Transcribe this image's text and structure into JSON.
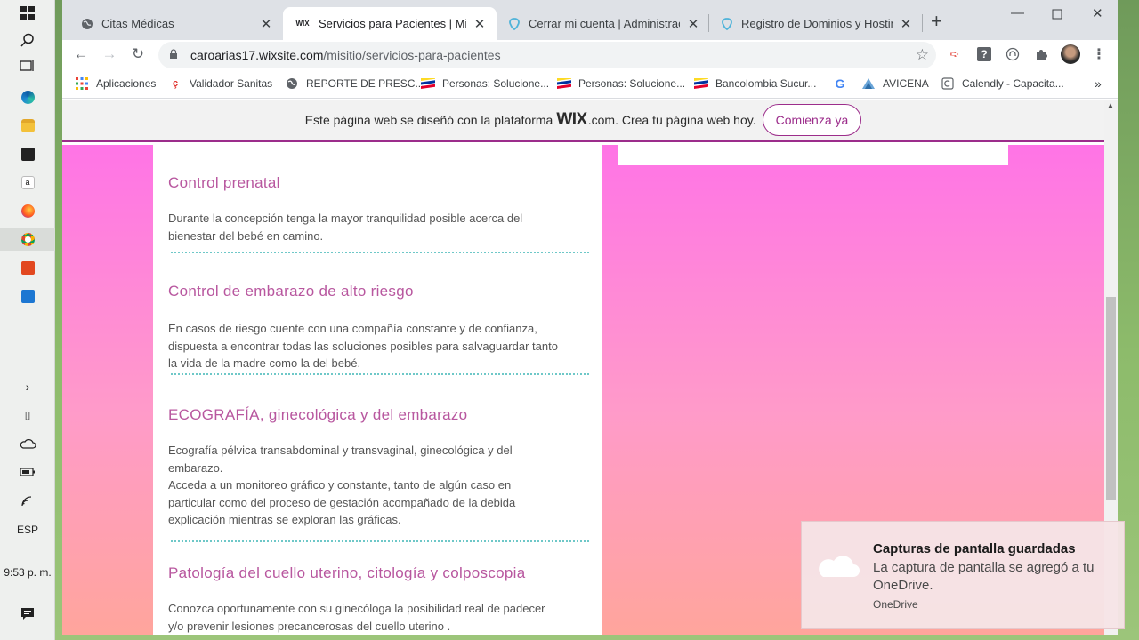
{
  "taskbar": {
    "language": "ESP",
    "clock": "9:53 p. m."
  },
  "tabs": [
    {
      "title": "Citas Médicas",
      "favicon": "globe-icon"
    },
    {
      "title": "Servicios para Pacientes | Misitio",
      "favicon": "wix-icon",
      "favicon_text": "WIX"
    },
    {
      "title": "Cerrar mi cuenta | Administración",
      "favicon": "hostinger-icon"
    },
    {
      "title": "Registro de Dominios y Hosting e",
      "favicon": "hostinger-icon"
    }
  ],
  "omnibox": {
    "host": "caroarias17.wixsite.com",
    "path": "/misitio/servicios-para-pacientes"
  },
  "bookmarks": [
    {
      "label": "Aplicaciones",
      "icon": "apps-grid-icon"
    },
    {
      "label": "Validador Sanitas",
      "icon": "sanitas-icon"
    },
    {
      "label": "REPORTE DE PRESC...",
      "icon": "globe-icon"
    },
    {
      "label": "Personas: Solucione...",
      "icon": "bancolombia-icon"
    },
    {
      "label": "Personas: Solucione...",
      "icon": "bancolombia-icon"
    },
    {
      "label": "Bancolombia Sucur...",
      "icon": "bancolombia-icon"
    },
    {
      "label": "",
      "icon": "google-icon",
      "text": "G"
    },
    {
      "label": "AVICENA",
      "icon": "avicena-icon"
    },
    {
      "label": "Calendly - Capacita...",
      "icon": "calendly-icon"
    }
  ],
  "wix_banner": {
    "text_before": "Este página web se diseñó con la plataforma",
    "logo": "WIX",
    "text_after": ".com. Crea tu página web hoy.",
    "cta": "Comienza ya"
  },
  "services": [
    {
      "title": "Control prenatal",
      "lines": [
        "Durante la concepción tenga la mayor tranquilidad posible acerca del",
        "bienestar del bebé en camino."
      ]
    },
    {
      "title": "Control de embarazo de alto riesgo",
      "lines": [
        "En casos de riesgo cuente con una compañía constante y de confianza,",
        "dispuesta a encontrar todas las soluciones posibles para salvaguardar tanto",
        "la vida de la madre como la del bebé."
      ]
    },
    {
      "title": "ECOGRAFÍA, ginecológica y del embarazo",
      "lines": [
        "Ecografía pélvica transabdominal y transvaginal, ginecológica y del",
        "embarazo.",
        "Acceda a un monitoreo gráfico y constante, tanto de algún caso en",
        "particular como del proceso de gestación acompañado de la debida",
        "explicación mientras se exploran las gráficas."
      ]
    },
    {
      "title": "Patología del cuello uterino, citología y colposcopia",
      "lines": [
        "Conozca oportunamente con su ginecóloga la posibilidad real de padecer",
        "y/o prevenir lesiones precancerosas del cuello uterino ."
      ]
    }
  ],
  "toast": {
    "title": "Capturas de pantalla guardadas",
    "body": "La captura de pantalla se agregó a tu OneDrive.",
    "app": "OneDrive"
  },
  "colors": {
    "accent_purple": "#9c2d8b",
    "service_title": "#b8579f",
    "divider_teal": "#6ec8c8"
  }
}
